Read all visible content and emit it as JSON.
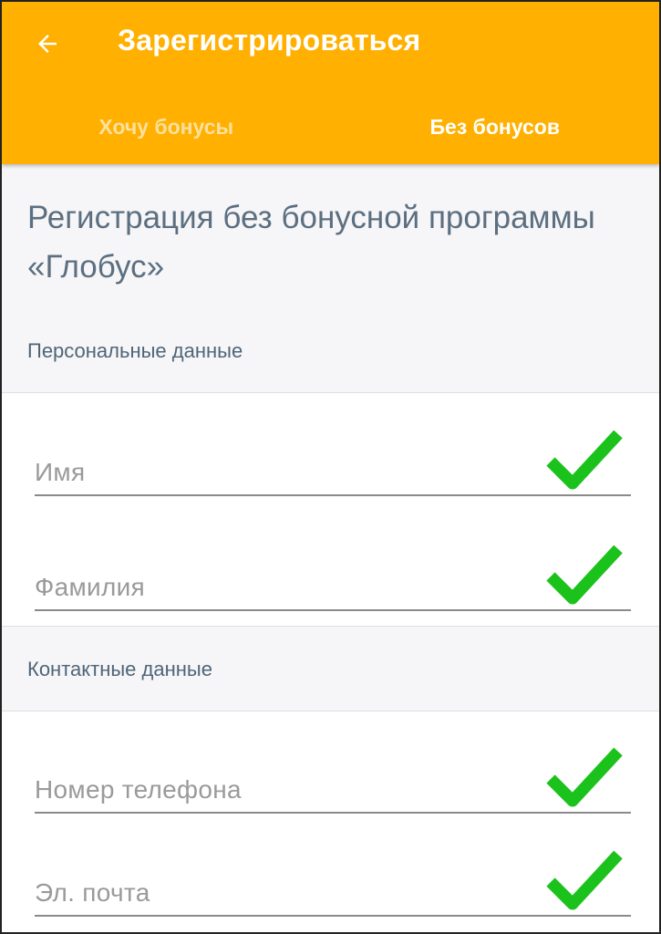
{
  "app_bar": {
    "title": "Зарегистрироваться",
    "back_icon": "arrow-left-icon",
    "background_color": "#ffb000"
  },
  "tabs": [
    {
      "label": "Хочу бонусы",
      "active": false
    },
    {
      "label": "Без бонусов",
      "active": true
    }
  ],
  "page": {
    "heading": "Регистрация без бонусной программы «Глобус»"
  },
  "sections": {
    "personal": {
      "label": "Персональные данные",
      "fields": [
        {
          "placeholder": "Имя",
          "value": "",
          "valid": true,
          "status_icon": "checkmark-icon"
        },
        {
          "placeholder": "Фамилия",
          "value": "",
          "valid": true,
          "status_icon": "checkmark-icon"
        }
      ]
    },
    "contacts": {
      "label": "Контактные данные",
      "fields": [
        {
          "placeholder": "Номер телефона",
          "value": "",
          "valid": true,
          "status_icon": "checkmark-icon"
        },
        {
          "placeholder": "Эл. почта",
          "value": "",
          "valid": true,
          "status_icon": "checkmark-icon"
        }
      ]
    }
  },
  "colors": {
    "accent": "#ffb000",
    "check": "#1cc21c",
    "heading": "#5c6f80"
  }
}
